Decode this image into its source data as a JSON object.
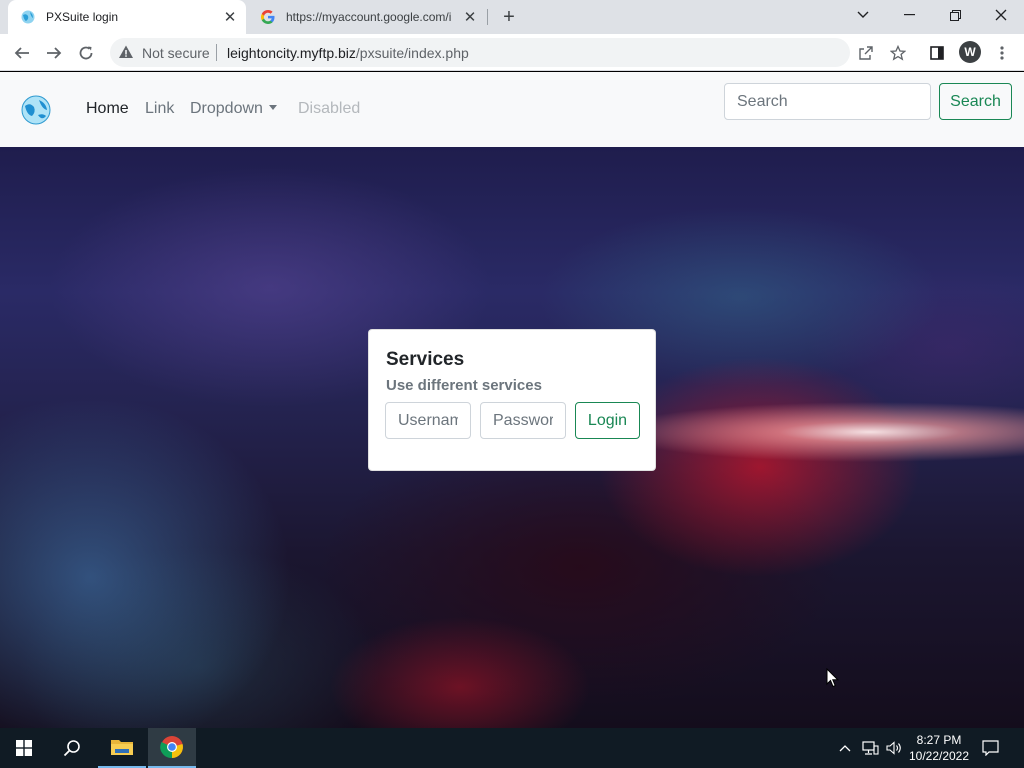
{
  "browser": {
    "tabs": [
      {
        "title": "PXSuite login",
        "active": true
      },
      {
        "title": "https://myaccount.google.com/i",
        "active": false
      }
    ],
    "address": {
      "security_label": "Not secure",
      "host": "leightoncity.myftp.biz",
      "path": "/pxsuite/index.php"
    },
    "profile_initial": "W"
  },
  "navbar": {
    "links": {
      "home": "Home",
      "link": "Link",
      "dropdown": "Dropdown",
      "disabled": "Disabled"
    },
    "search": {
      "placeholder": "Search",
      "button_label": "Search"
    }
  },
  "login_card": {
    "title": "Services",
    "subtitle": "Use different services",
    "username_placeholder": "Username",
    "password_placeholder": "Password",
    "login_label": "Login"
  },
  "taskbar": {
    "time": "8:27 PM",
    "date": "10/22/2022"
  },
  "colors": {
    "accent_green": "#198754",
    "navbar_bg": "#f8f9fa",
    "taskbar_bg": "#101b24"
  }
}
